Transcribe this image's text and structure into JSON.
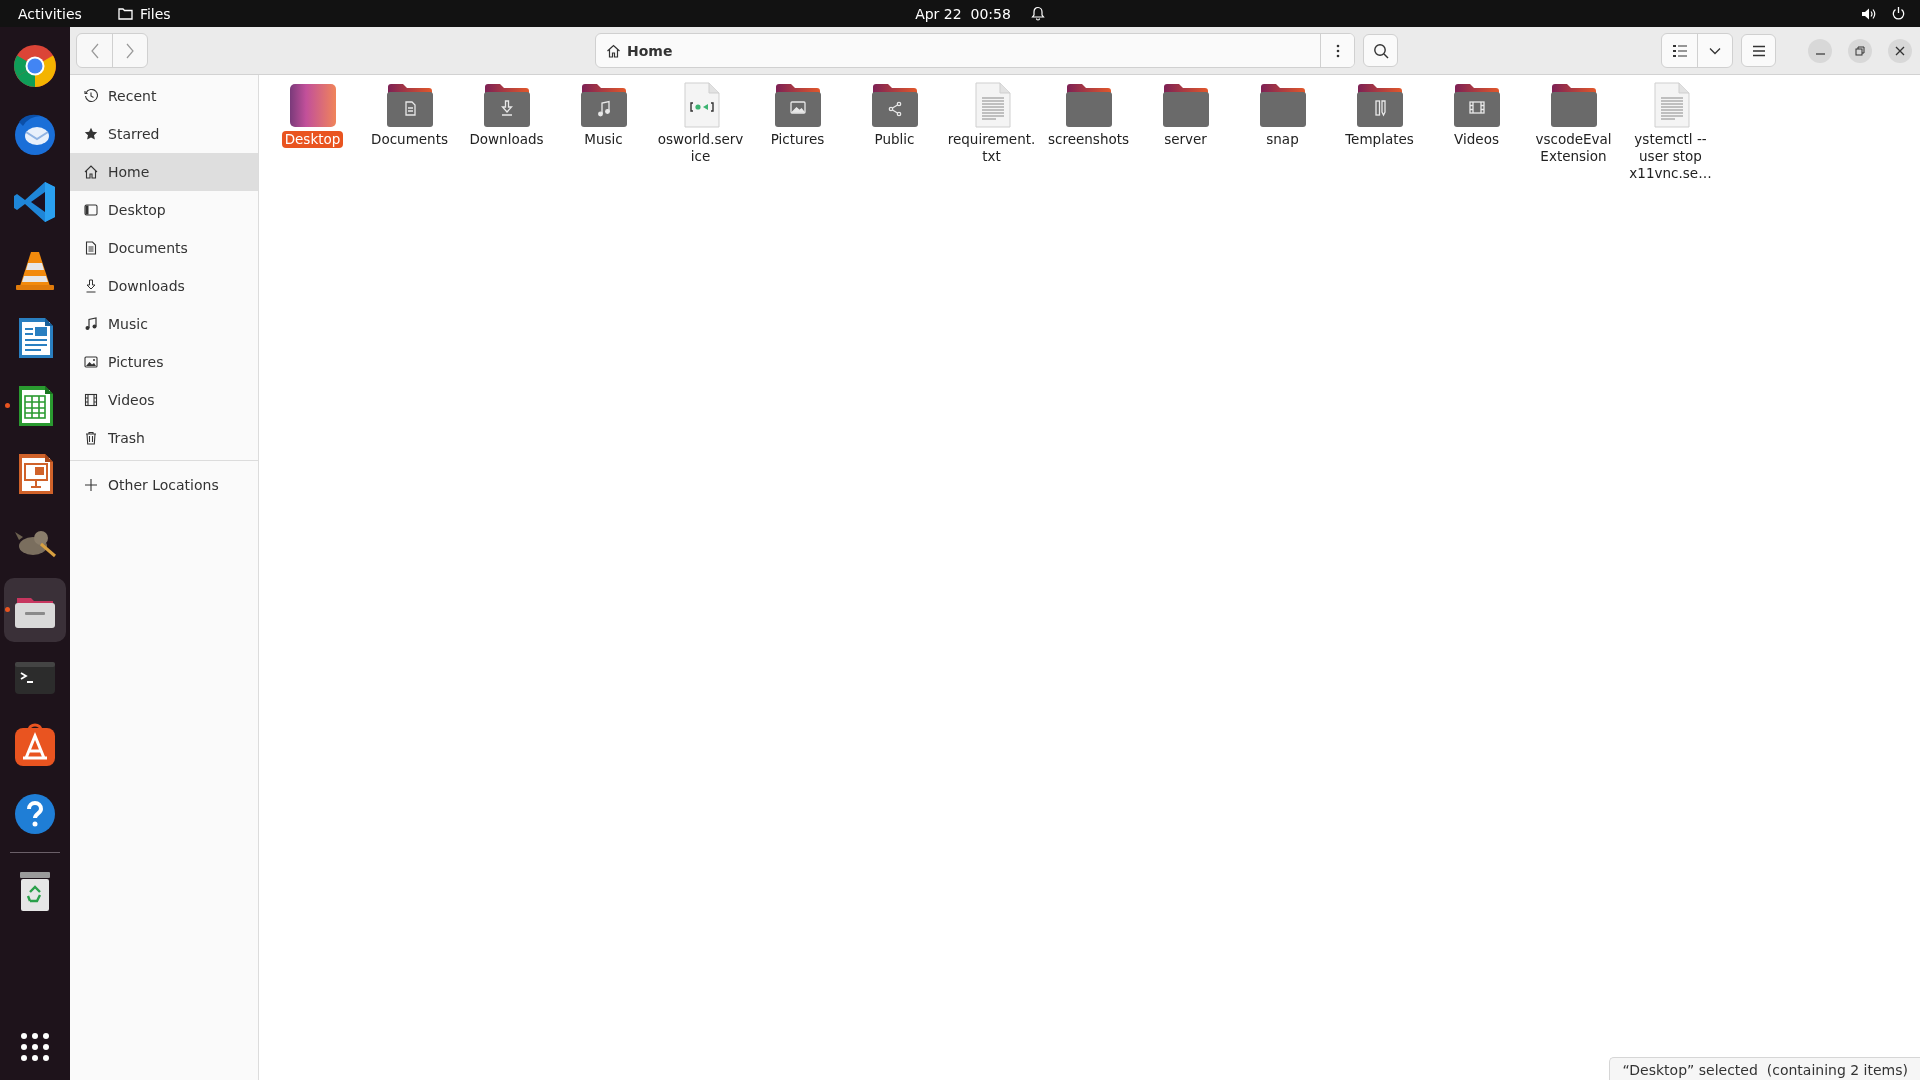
{
  "top_bar": {
    "activities": "Activities",
    "app_name": "Files",
    "clock": "Apr 22  00:58"
  },
  "dock": [
    {
      "kind": "browser",
      "running": false,
      "selected": false
    },
    {
      "kind": "mail",
      "running": false,
      "selected": false
    },
    {
      "kind": "code",
      "running": false,
      "selected": false
    },
    {
      "kind": "cone",
      "running": false,
      "selected": false
    },
    {
      "kind": "writer",
      "running": false,
      "selected": false
    },
    {
      "kind": "calc",
      "running": true,
      "selected": false
    },
    {
      "kind": "impress",
      "running": false,
      "selected": false
    },
    {
      "kind": "paint",
      "running": false,
      "selected": false
    },
    {
      "kind": "files",
      "running": true,
      "selected": true
    },
    {
      "kind": "terminal",
      "running": false,
      "selected": false
    },
    {
      "kind": "store",
      "running": false,
      "selected": false
    },
    {
      "kind": "help",
      "running": false,
      "selected": false
    },
    {
      "kind": "trash",
      "running": false,
      "selected": false
    }
  ],
  "header": {
    "location": "Home"
  },
  "sidebar": {
    "items": [
      {
        "kind": "clock",
        "label": "Recent",
        "selected": false
      },
      {
        "kind": "star",
        "label": "Starred",
        "selected": false
      },
      {
        "kind": "home",
        "label": "Home",
        "selected": true
      },
      {
        "kind": "desktop",
        "label": "Desktop",
        "selected": false
      },
      {
        "kind": "document",
        "label": "Documents",
        "selected": false
      },
      {
        "kind": "download",
        "label": "Downloads",
        "selected": false
      },
      {
        "kind": "music",
        "label": "Music",
        "selected": false
      },
      {
        "kind": "picture",
        "label": "Pictures",
        "selected": false
      },
      {
        "kind": "video",
        "label": "Videos",
        "selected": false
      },
      {
        "kind": "trash",
        "label": "Trash",
        "selected": false
      }
    ],
    "other": {
      "label": "Other Locations"
    }
  },
  "files": [
    {
      "name": "Desktop",
      "kind": "desktop",
      "selected": true
    },
    {
      "name": "Documents",
      "kind": "document",
      "selected": false
    },
    {
      "name": "Downloads",
      "kind": "download",
      "selected": false
    },
    {
      "name": "Music",
      "kind": "music",
      "selected": false
    },
    {
      "name": "osworld.service",
      "kind": "service",
      "selected": false
    },
    {
      "name": "Pictures",
      "kind": "picture",
      "selected": false
    },
    {
      "name": "Public",
      "kind": "share",
      "selected": false
    },
    {
      "name": "requirement.txt",
      "kind": "text",
      "selected": false
    },
    {
      "name": "screenshots",
      "kind": "folder",
      "selected": false
    },
    {
      "name": "server",
      "kind": "folder",
      "selected": false
    },
    {
      "name": "snap",
      "kind": "folder",
      "selected": false
    },
    {
      "name": "Templates",
      "kind": "template",
      "selected": false
    },
    {
      "name": "Videos",
      "kind": "video",
      "selected": false
    },
    {
      "name": "vscodeEval Extension",
      "kind": "folder",
      "selected": false
    },
    {
      "name": "ystemctl --user stop x11vnc.se…",
      "kind": "text",
      "selected": false
    }
  ],
  "status": "“Desktop” selected  (containing 2 items)"
}
